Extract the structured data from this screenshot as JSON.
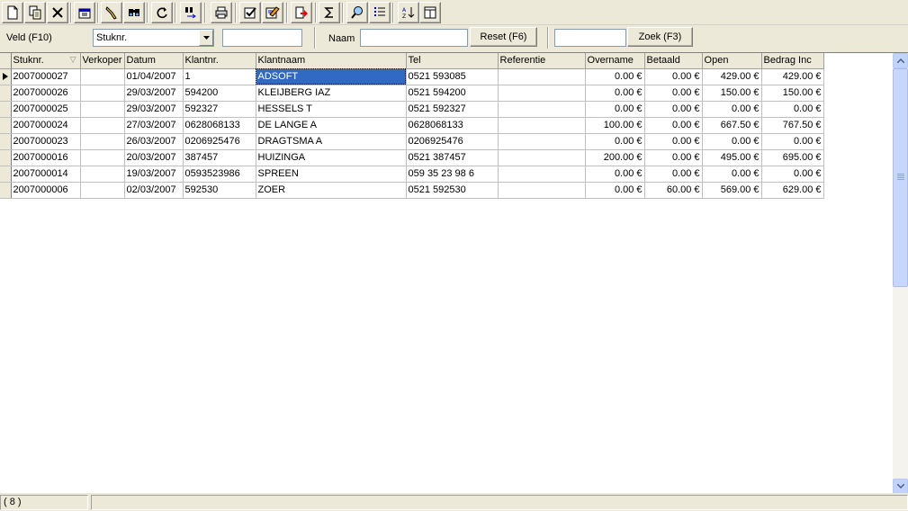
{
  "filter": {
    "veld_label": "Veld (F10)",
    "veld_value": "Stuknr.",
    "veld_search_value": "",
    "naam_label": "Naam",
    "naam_value": "",
    "reset_label": "Reset (F6)",
    "zoek_value": "",
    "zoek_label": "Zoek (F3)"
  },
  "toolbar": {
    "buttons": [
      {
        "icon": "new-document-icon"
      },
      {
        "icon": "copy-document-icon"
      },
      {
        "icon": "delete-icon"
      },
      {
        "icon": "properties-icon"
      },
      {
        "icon": "filter-icon"
      },
      {
        "icon": "find-icon"
      },
      {
        "icon": "refresh-icon"
      },
      {
        "icon": "find-next-icon"
      },
      {
        "icon": "print-icon"
      },
      {
        "icon": "check-icon"
      },
      {
        "icon": "edit-icon"
      },
      {
        "icon": "export-icon"
      },
      {
        "icon": "sum-icon"
      },
      {
        "icon": "search-zoom-icon"
      },
      {
        "icon": "list-icon"
      },
      {
        "icon": "sort-az-icon"
      },
      {
        "icon": "columns-icon"
      }
    ]
  },
  "grid": {
    "columns": [
      "Stuknr.",
      "Verkoper",
      "Datum",
      "Klantnr.",
      "Klantnaam",
      "Tel",
      "Referentie",
      "Overname",
      "Betaald",
      "Open",
      "Bedrag Inc"
    ],
    "rows": [
      [
        "2007000027",
        "",
        "01/04/2007",
        "1",
        "ADSOFT",
        "0521 593085",
        "",
        "0.00 €",
        "0.00 €",
        "429.00 €",
        "429.00 €"
      ],
      [
        "2007000026",
        "",
        "29/03/2007",
        "594200",
        "KLEIJBERG IAZ",
        "0521 594200",
        "",
        "0.00 €",
        "0.00 €",
        "150.00 €",
        "150.00 €"
      ],
      [
        "2007000025",
        "",
        "29/03/2007",
        "592327",
        "HESSELS T",
        "0521 592327",
        "",
        "0.00 €",
        "0.00 €",
        "0.00 €",
        "0.00 €"
      ],
      [
        "2007000024",
        "",
        "27/03/2007",
        "0628068133",
        "DE LANGE A",
        "0628068133",
        "",
        "100.00 €",
        "0.00 €",
        "667.50 €",
        "767.50 €"
      ],
      [
        "2007000023",
        "",
        "26/03/2007",
        "0206925476",
        "DRAGTSMA A",
        "0206925476",
        "",
        "0.00 €",
        "0.00 €",
        "0.00 €",
        "0.00 €"
      ],
      [
        "2007000016",
        "",
        "20/03/2007",
        "387457",
        "HUIZINGA",
        "0521 387457",
        "",
        "200.00 €",
        "0.00 €",
        "495.00 €",
        "695.00 €"
      ],
      [
        "2007000014",
        "",
        "19/03/2007",
        "0593523986",
        "SPREEN",
        "059 35 23 98 6",
        "",
        "0.00 €",
        "0.00 €",
        "0.00 €",
        "0.00 €"
      ],
      [
        "2007000006",
        "",
        "02/03/2007",
        "592530",
        "ZOER",
        "0521 592530",
        "",
        "0.00 €",
        "60.00 €",
        "569.00 €",
        "629.00 €"
      ]
    ]
  },
  "status": {
    "count": "( 8 )",
    "message": ""
  },
  "colors": {
    "selection": "#316ac5",
    "chrome": "#ece9d8"
  }
}
